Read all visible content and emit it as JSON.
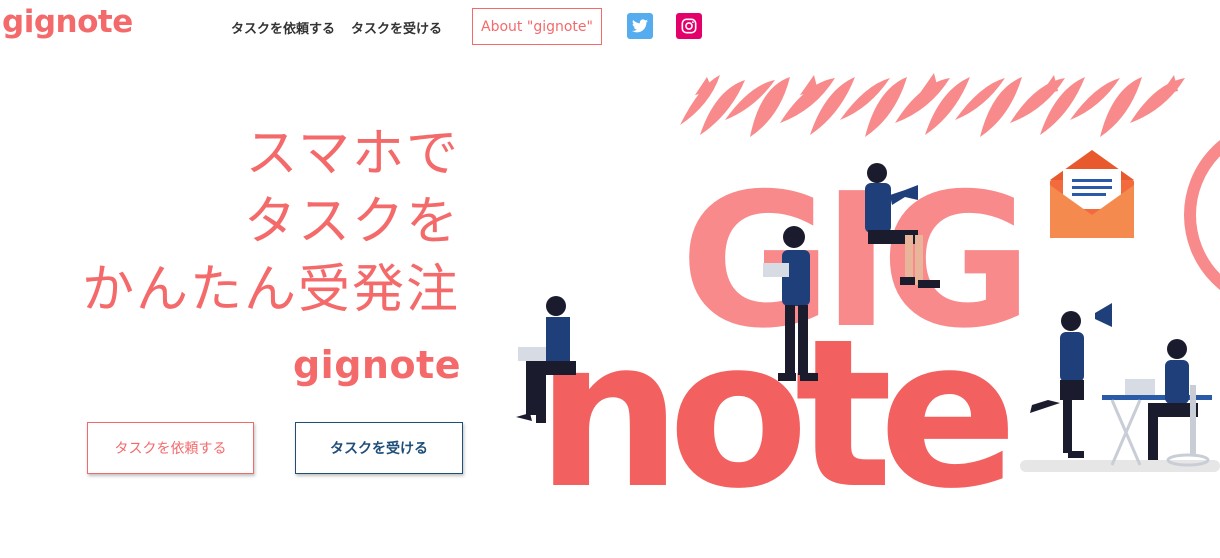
{
  "header": {
    "logo": "gignote",
    "nav": {
      "request_task": "タスクを依頼する",
      "accept_task": "タスクを受ける",
      "about": "About \"gignote\""
    },
    "social": [
      {
        "name": "twitter",
        "icon": "twitter-icon",
        "color": "#55acee"
      },
      {
        "name": "instagram",
        "icon": "instagram-icon",
        "color": "#e4006b"
      }
    ]
  },
  "hero": {
    "headline": [
      "スマホで",
      "タスクを",
      "かんたん受発注"
    ],
    "brand": "gignote",
    "buttons": {
      "request": "タスクを依頼する",
      "accept": "タスクを受ける"
    }
  },
  "illustration": {
    "big_text_top": "GIG",
    "big_text_bottom": "note",
    "colors": {
      "accent": "#f46a6b",
      "gig": "#f88a8b",
      "note": "#f2605f",
      "navy": "#1f3f7a",
      "envelope": "#f26a3d"
    }
  },
  "colors": {
    "brand": "#f46a6b",
    "navy_button": "#1f4e79"
  }
}
